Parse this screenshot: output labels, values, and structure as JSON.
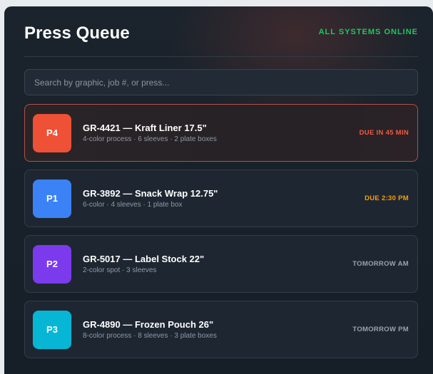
{
  "header": {
    "title": "Press Queue",
    "status": "ALL SYSTEMS ONLINE",
    "status_color": "#22c55e"
  },
  "search": {
    "placeholder": "Search by graphic, job #, or press...",
    "value": ""
  },
  "jobs": [
    {
      "press": "P4",
      "press_color": "#ee5136",
      "title": "GR-4421 — Kraft Liner 17.5\"",
      "meta": "4-color process · 6 sleeves · 2 plate boxes",
      "due": "DUE IN 45 MIN",
      "due_color": "#ef5b43",
      "urgent": true
    },
    {
      "press": "P1",
      "press_color": "#3b82f6",
      "title": "GR-3892 — Snack Wrap 12.75\"",
      "meta": "6-color · 4 sleeves · 1 plate box",
      "due": "DUE 2:30 PM",
      "due_color": "#f59e0b",
      "urgent": false
    },
    {
      "press": "P2",
      "press_color": "#7c3aed",
      "title": "GR-5017 — Label Stock 22\"",
      "meta": "2-color spot · 3 sleeves",
      "due": "TOMORROW AM",
      "due_color": "#9aa3ad",
      "urgent": false
    },
    {
      "press": "P3",
      "press_color": "#06b6d4",
      "title": "GR-4890 — Frozen Pouch 26\"",
      "meta": "8-color process · 8 sleeves · 3 plate boxes",
      "due": "TOMORROW PM",
      "due_color": "#9aa3ad",
      "urgent": false
    }
  ]
}
